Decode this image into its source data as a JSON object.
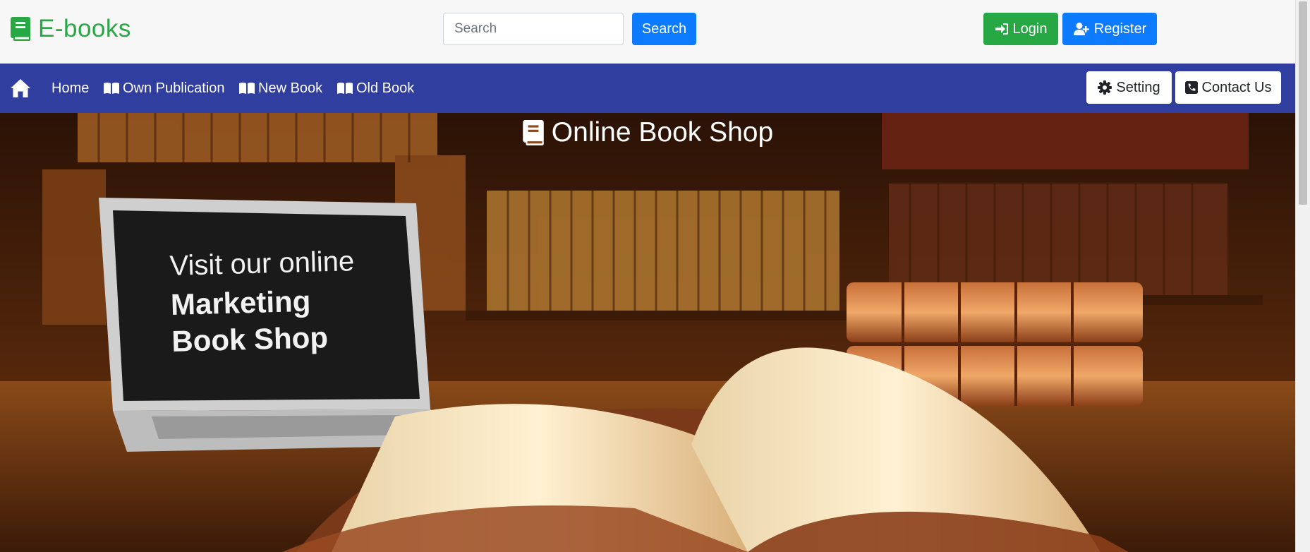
{
  "header": {
    "brand": "E-books",
    "search_placeholder": "Search",
    "search_button": "Search",
    "login_button": "Login",
    "register_button": "Register"
  },
  "nav": {
    "home": "Home",
    "own_publication": "Own Publication",
    "new_book": "New Book",
    "old_book": "Old Book",
    "setting": "Setting",
    "contact_us": "Contact Us"
  },
  "hero": {
    "title": "Online Book Shop",
    "screen_line1": "Visit our online",
    "screen_line2": "Marketing",
    "screen_line3": "Book Shop"
  },
  "colors": {
    "brand_green": "#28a745",
    "primary_blue": "#0d7bff",
    "nav_bg": "#303f9f"
  },
  "icons": {
    "brand": "book-icon",
    "login": "sign-in-icon",
    "register": "user-plus-icon",
    "home": "home-icon",
    "nav_book": "book-open-icon",
    "setting": "gear-icon",
    "contact": "phone-square-icon",
    "hero": "book-icon"
  }
}
